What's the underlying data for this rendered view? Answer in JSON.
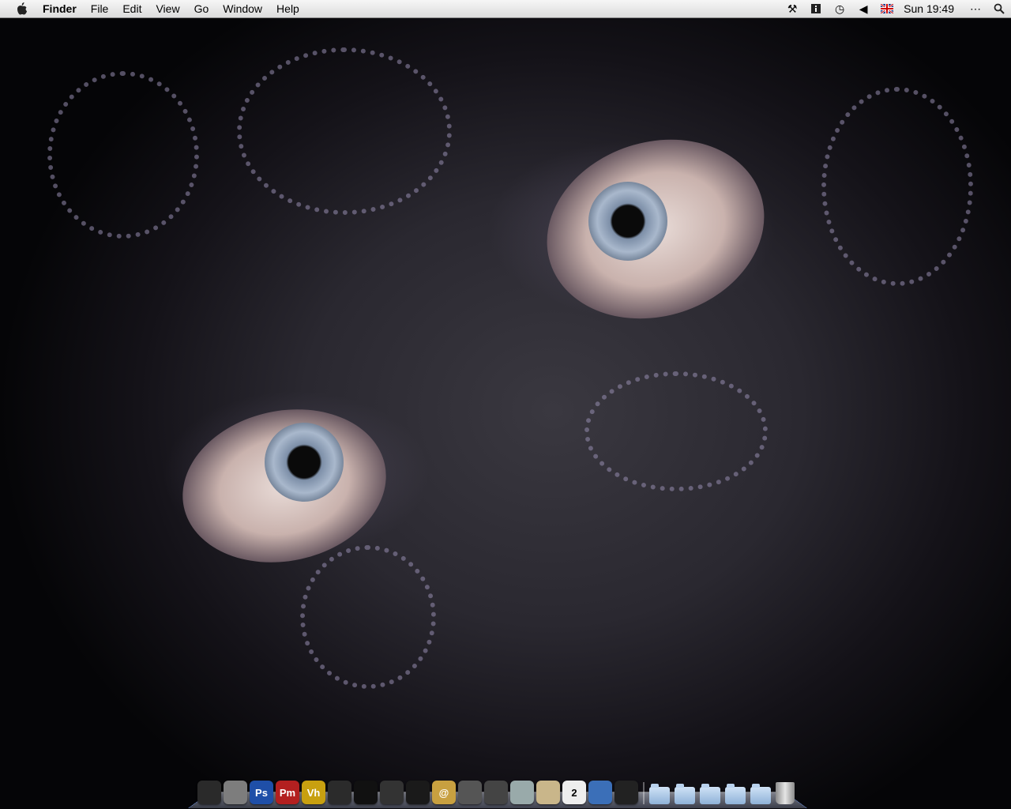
{
  "menubar": {
    "app_name": "Finder",
    "items": [
      "File",
      "Edit",
      "View",
      "Go",
      "Window",
      "Help"
    ],
    "clock": "Sun 19:49",
    "status_icons": [
      "tools-icon",
      "info-icon",
      "time-machine-icon",
      "volume-icon",
      "uk-flag-icon",
      "dots-icon",
      "spotlight-icon"
    ]
  },
  "dock": {
    "apps": [
      {
        "name": "jack-skellington-icon",
        "label": "",
        "bg": "#2a2a2a"
      },
      {
        "name": "preferences-icon",
        "label": "",
        "bg": "#7d7d7d"
      },
      {
        "name": "photoshop-icon",
        "label": "Ps",
        "bg": "#1f4fa8"
      },
      {
        "name": "pagemaker-icon",
        "label": "Pm",
        "bg": "#b32020"
      },
      {
        "name": "vh-icon",
        "label": "Vh",
        "bg": "#c8a010"
      },
      {
        "name": "itunes-icon",
        "label": "",
        "bg": "#2b2b2b"
      },
      {
        "name": "color-picker-icon",
        "label": "",
        "bg": "#111"
      },
      {
        "name": "mail-stamp-icon",
        "label": "",
        "bg": "#333"
      },
      {
        "name": "compass-icon",
        "label": "",
        "bg": "#1a1a1a"
      },
      {
        "name": "address-book-icon",
        "label": "@",
        "bg": "#c8a040"
      },
      {
        "name": "pen-tool-icon",
        "label": "",
        "bg": "#555"
      },
      {
        "name": "stats-icon",
        "label": "",
        "bg": "#444"
      },
      {
        "name": "globe-icon",
        "label": "",
        "bg": "#9aa"
      },
      {
        "name": "notes-icon",
        "label": "",
        "bg": "#c9b68a"
      },
      {
        "name": "calendar-icon",
        "label": "2",
        "bg": "#eee"
      },
      {
        "name": "network-icon",
        "label": "",
        "bg": "#3b6fb8"
      },
      {
        "name": "activity-monitor-icon",
        "label": "",
        "bg": "#222"
      }
    ],
    "folders": [
      "applications-folder-icon",
      "documents-folder-icon",
      "downloads-folder-icon",
      "utilities-folder-icon",
      "sites-folder-icon"
    ]
  }
}
